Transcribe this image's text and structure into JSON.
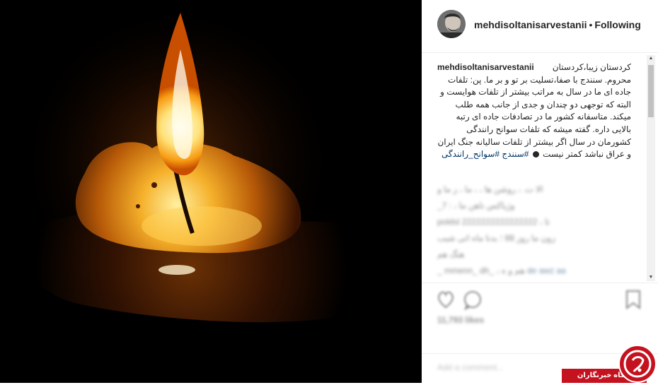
{
  "post": {
    "username": "mehdisoltanisarvestanii",
    "separator": "•",
    "follow_label": "Following",
    "caption_user": "mehdisoltanisarvestanii",
    "caption_text": "کردستان زیبا،کردستان محروم. سنندج با صفا،تسلیت بر تو و بر ما. پن: تلفات جاده ای ما در سال به مراتب بیشتر از تلفات هوایست و البته که توجهی دو چندان و جدی از جانب همه طلب میکند. متاسفانه کشور ما در تصادفات جاده ای رتبه بالایی داره. گفته میشه که تلفات سوانح رانندگی کشورمان در سال اگر بیشتر از تلفات سالیانه جنگ ایران و عراق نباشد کمتر نیست",
    "caption_tags": "#سنندج #سوانح_رانندگی"
  },
  "blurred_comments": [
    {
      "text": "الا ت. ، روشن ها ، ، ما ، ز ما و"
    },
    {
      "text": "_7 : ، وژیاکس ناهن ما"
    },
    {
      "text": "poldsl 2222222222222222 ، تا"
    },
    {
      "text": "زون ما روز 88 ؛ بدنا ماه اتی شبب"
    },
    {
      "text": "هنگ هم"
    },
    {
      "text": "_ mmenn_ dh_ ، هم و ه",
      "link": "de awz aa"
    }
  ],
  "likes_label": "11,793 likes",
  "add_comment_placeholder": "Add a comment...",
  "watermark": {
    "label": "باشگاه خبرنگاران"
  },
  "icons": {
    "like": "heart-icon",
    "comment": "comment-icon",
    "save": "bookmark-icon",
    "avatar": "avatar"
  }
}
